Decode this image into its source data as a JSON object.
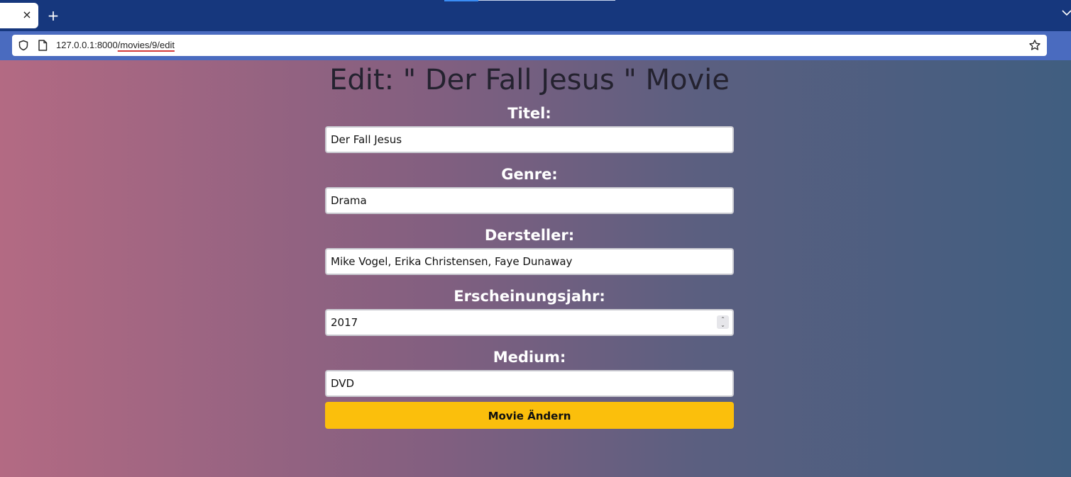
{
  "browser": {
    "tab_close_glyph": "×",
    "new_tab_glyph": "+",
    "url_host": "127.0.0.1:8000",
    "url_path": "/movies/9/edit",
    "icons": {
      "shield": "shield-icon",
      "page": "page-icon",
      "star": "star-icon",
      "list_tabs": "chevron-down-icon"
    }
  },
  "page": {
    "title": "Edit: \" Der Fall Jesus \" Movie",
    "fields": {
      "titel": {
        "label": "Titel:",
        "value": "Der Fall Jesus"
      },
      "genre": {
        "label": "Genre:",
        "value": "Drama"
      },
      "darsteller": {
        "label": "Dersteller:",
        "value": "Mike Vogel, Erika Christensen, Faye Dunaway"
      },
      "jahr": {
        "label": "Erscheinungsjahr:",
        "value": "2017"
      },
      "medium": {
        "label": "Medium:",
        "value": "DVD"
      }
    },
    "submit_label": "Movie Ändern",
    "colors": {
      "gradient_left": "#b36a83",
      "gradient_right": "#405e80",
      "button": "#fbbf0c",
      "tabstrip": "#16377d",
      "navbar": "#4a6bbf"
    }
  }
}
